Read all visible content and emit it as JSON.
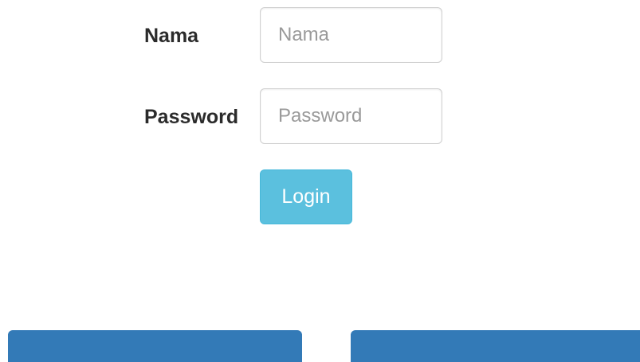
{
  "form": {
    "nama_label": "Nama",
    "nama_placeholder": "Nama",
    "nama_value": "",
    "password_label": "Password",
    "password_placeholder": "Password",
    "password_value": "",
    "login_label": "Login"
  },
  "colors": {
    "login_button": "#5bc0de",
    "bottom_buttons": "#337ab7"
  }
}
